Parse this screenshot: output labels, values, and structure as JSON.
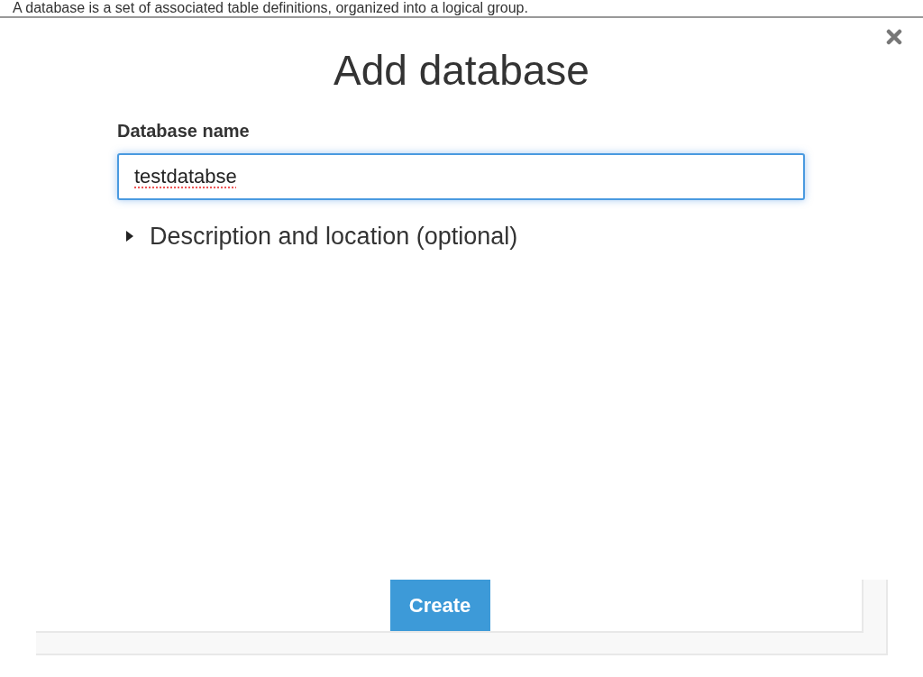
{
  "background_text": "A database is a set of associated table definitions, organized into a logical group.",
  "dialog": {
    "title": "Add database",
    "fields": [
      {
        "label": "Database name",
        "value": "testdatabse",
        "focused": true
      }
    ],
    "expander": {
      "label": "Description and location (optional)",
      "expanded": false
    },
    "buttons": [
      {
        "label": "Create",
        "kind": "primary"
      }
    ]
  }
}
